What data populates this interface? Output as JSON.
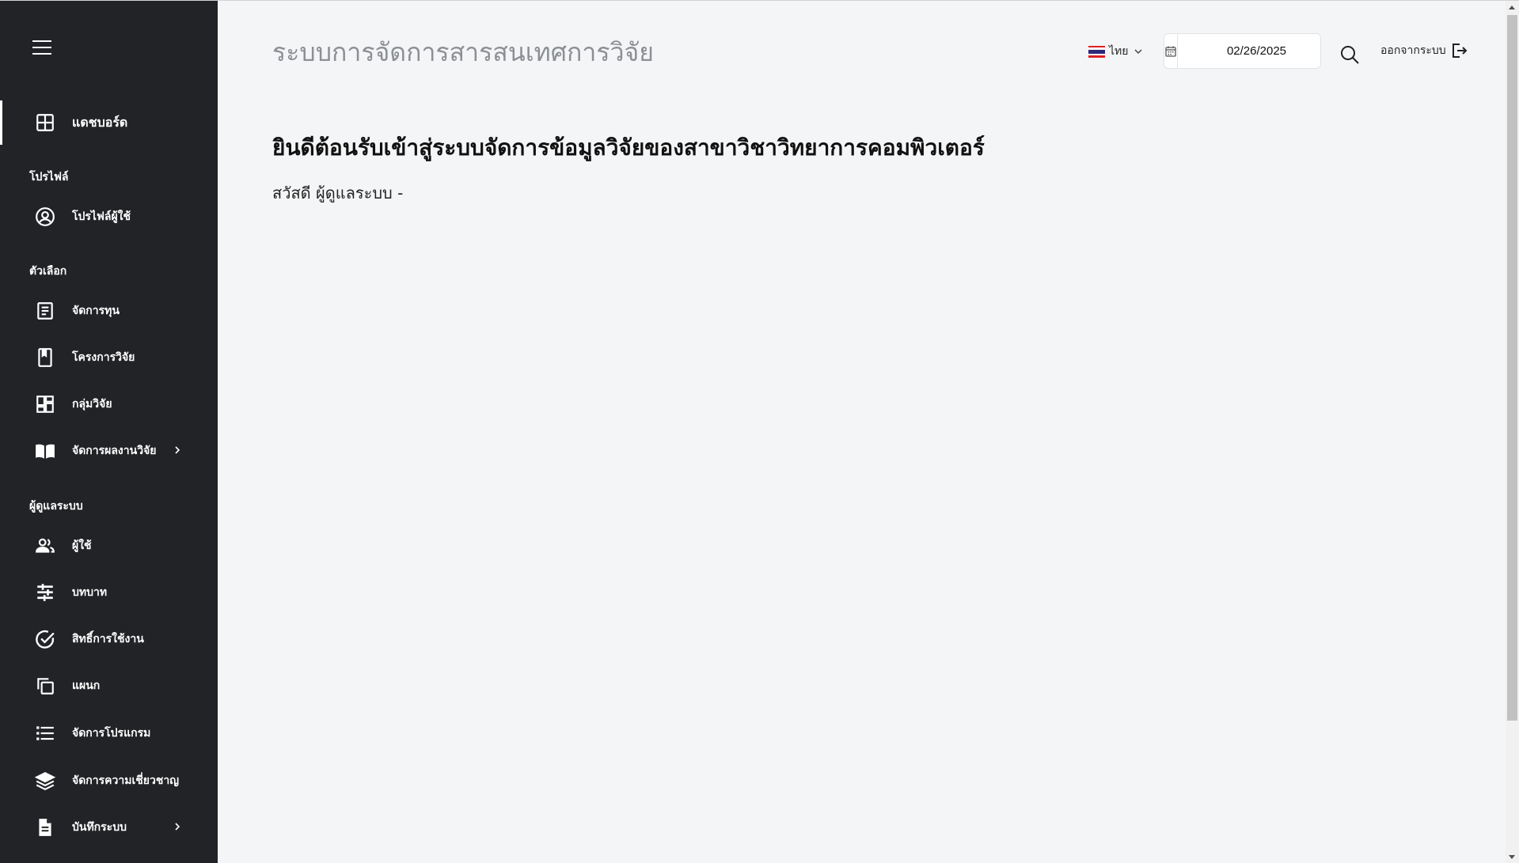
{
  "app": {
    "title": "ระบบการจัดการสารสนเทศการวิจัย"
  },
  "header": {
    "language": "ไทย",
    "date_value": "02/26/2025",
    "logout_label": "ออกจากระบบ"
  },
  "sidebar": {
    "dashboard_label": "แดชบอร์ด",
    "sections": {
      "profile": "โปรไฟล์",
      "options": "ตัวเลือก",
      "admin": "ผู้ดูแลระบบ"
    },
    "items": {
      "user_profile": "โปรไฟล์ผู้ใช้",
      "manage_funds": "จัดการทุน",
      "research_projects": "โครงการวิจัย",
      "research_groups": "กลุ่มวิจัย",
      "manage_research_output": "จัดการผลงานวิจัย",
      "users": "ผู้ใช้",
      "roles": "บทบาท",
      "permissions": "สิทธิ์การใช้งาน",
      "departments": "แผนก",
      "manage_programs": "จัดการโปรแกรม",
      "manage_expertise": "จัดการความเชี่ยวชาญ",
      "system_logs": "บันทึกระบบ"
    }
  },
  "main": {
    "welcome": "ยินดีต้อนรับเข้าสู่ระบบจัดการข้อมูลวิจัยของสาขาวิชาวิทยาการคอมพิวเตอร์",
    "greeting": "สวัสดี ผู้ดูแลระบบ -"
  },
  "colors": {
    "sidebar_bg": "#222327",
    "page_bg": "#f4f5f7",
    "title_gray": "#8c8f94"
  }
}
